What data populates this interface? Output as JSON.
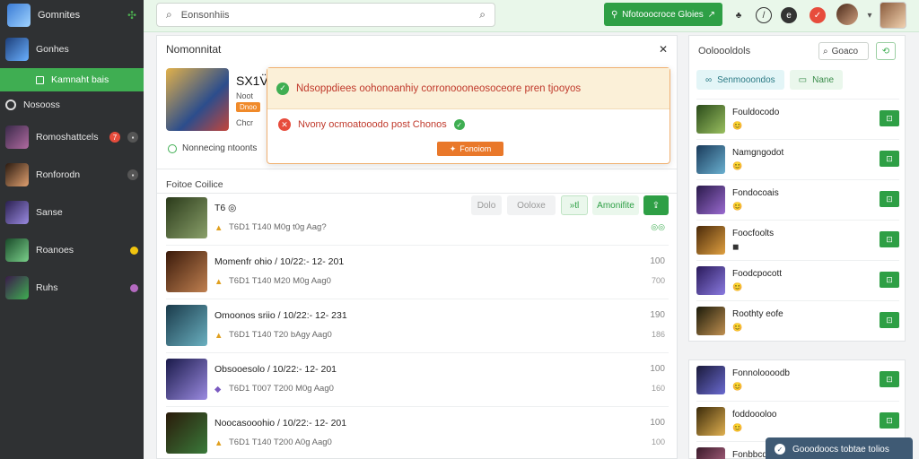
{
  "sidebar": {
    "app_title": "Gomnites",
    "items": [
      {
        "label": "Gonhes",
        "avatar": "#4a7fc0"
      },
      {
        "label": "Kamnaht bais",
        "active": true
      },
      {
        "label": "Nosooss"
      },
      {
        "label": "Romoshattcels",
        "badge": "7",
        "avatar": "#7a5a8c"
      },
      {
        "label": "Ronforodn",
        "avatar": "#9a5b3a"
      },
      {
        "label": "Sanse",
        "avatar": "#6a5bb0"
      },
      {
        "label": "Roanoes",
        "avatar": "#3b8a4a"
      },
      {
        "label": "Ruhs",
        "avatar": "#8a3b8c"
      }
    ]
  },
  "topbar": {
    "search_value": "Eonsonhiis",
    "cta_label": "Nfotooocroce Gloies"
  },
  "main": {
    "title": "Nomonnitat",
    "profile": {
      "name": "SX1V̈",
      "line1": "Noot",
      "tag": "Dnoo",
      "meta": "Chcr"
    },
    "repeat_text": "Nonnecing ntoonts",
    "section_title": "Foitoe Coilice",
    "toolbar": {
      "b1": "Dolo",
      "b2": "Ooloxe",
      "b3": "»tl",
      "b4": "Amonifite"
    },
    "rows": [
      {
        "title": "T6 ◎",
        "sub": "T6D1 T140 M0g t0g   Aag?",
        "v1": "",
        "v2": "◎◎",
        "thumb": "#4f6a3a"
      },
      {
        "title": "Momenfr ohio / 10/22:- 12-  201",
        "sub": "T6D1 T140 M20 M0g   Aag0",
        "v1": "100",
        "v2": "700",
        "thumb": "#7a4a2a"
      },
      {
        "title": "Omoonos sriio / 10/22:- 12-  231",
        "sub": "T6D1 T140 T20 bAgy   Aag0",
        "v1": "190",
        "v2": "186",
        "thumb": "#3a6a8a"
      },
      {
        "title": "Obsooesolo / 10/22:- 12-  201",
        "sub": "T6D1 T007 T200 M0g   Aag0",
        "v1": "100",
        "v2": "160",
        "thumb": "#5a4a9a"
      },
      {
        "title": "Noocasooohio / 10/22:- 12-  201",
        "sub": "T6D1 T140 T200 A0g   Aag0",
        "v1": "100",
        "v2": "100",
        "thumb": "#6a3a2a"
      }
    ]
  },
  "toast": {
    "top_text": "Ndsoppdiees oohonoanhiy corronoooneosoceore pren tjooyos",
    "mid_text": "Nvony ocmoatooodo post Chonos",
    "button_label": "Fonoiom"
  },
  "right_panel": {
    "title": "Ooloooldols",
    "search_label": "Goaco",
    "tab1": "Senmooondos",
    "tab2": "Nane",
    "items": [
      {
        "name": "Fouldocodo",
        "thumb": "#6b8a3a"
      },
      {
        "name": "Namgngodot",
        "thumb": "#2e6a8c"
      },
      {
        "name": "Fondocoais",
        "thumb": "#5a3a8a"
      },
      {
        "name": "Foocfoolts",
        "thumb": "#8a4a2a"
      },
      {
        "name": "Foodcpocott",
        "thumb": "#6a4a9a"
      },
      {
        "name": "Roothty eofe",
        "thumb": "#4a3a2a"
      }
    ]
  },
  "right_panel2": {
    "items": [
      {
        "name": "Fonnoloooodb",
        "thumb": "#2a3a6a"
      },
      {
        "name": "foddoooloo",
        "thumb": "#8a6a2a"
      },
      {
        "name": "Fonbbcd",
        "thumb": "#6a3a5a"
      }
    ]
  },
  "notification": {
    "text": "Gooodoocs tobtae tolios"
  }
}
